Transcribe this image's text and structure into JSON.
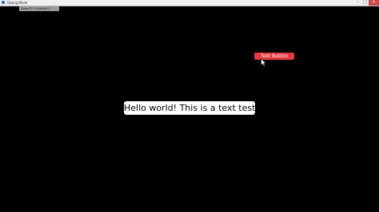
{
  "window": {
    "title": "Debug Mode",
    "controls": {
      "minimize": "–",
      "maximize": "□",
      "close": "✕"
    }
  },
  "tab": {
    "label": "PowerTT 3 Scaffold 2"
  },
  "scene": {
    "button_label": "Text Button",
    "hello_text": "Hello world! This is a text test!"
  },
  "colors": {
    "button": "#e23a3f",
    "background": "#000000",
    "text_box": "#ffffff"
  },
  "icons": [
    "app-icon",
    "mouse-cursor-icon"
  ]
}
